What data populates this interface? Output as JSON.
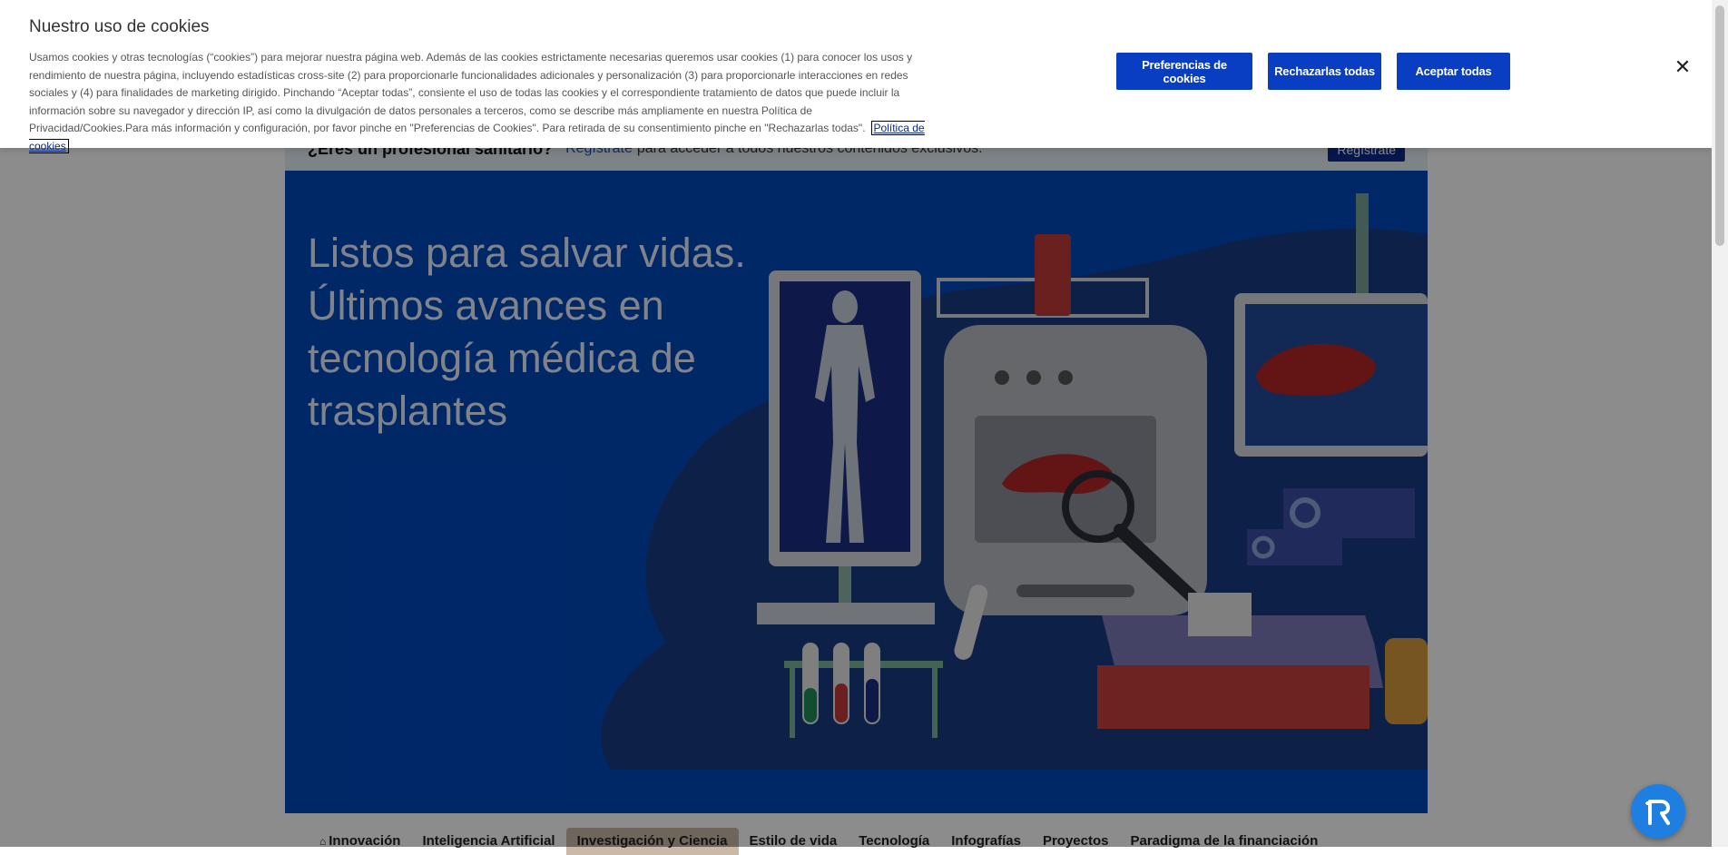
{
  "cookie_banner": {
    "title": "Nuestro uso de cookies",
    "description": "Usamos cookies y otras tecnologías (“cookies”) para mejorar nuestra página web. Además de las cookies estrictamente necesarias queremos usar cookies (1) para conocer los usos y rendimiento de nuestra página, incluyendo estadísticas cross-site (2) para proporcionarle funcionalidades adicionales y personalización (3) para proporcionarle interacciones en redes sociales y (4) para finalidades de marketing dirigido. Pinchando “Aceptar todas”, consiente el uso de todas las cookies y el correspondiente tratamiento de datos que puede incluir la información sobre su navegador y dirección IP, así como la divulgación de datos personales a terceros, como se describe más ampliamente en nuestra Política de Privacidad/Cookies.Para más información y configuración, por favor pinche en \"Preferencias de Cookies\". Para retirada de su consentimiento pinche en \"Rechazarlas todas\".",
    "policy_link": "Política de cookies",
    "buttons": {
      "preferences": "Preferencias de cookies",
      "reject_all": "Rechazarlas todas",
      "accept_all": "Aceptar todas"
    },
    "close_icon": "✕"
  },
  "promo_bar": {
    "question": "¿Eres un profesional sanitario?",
    "register_link": "Regístrate",
    "text": "para acceder a todos nuestros contenidos exclusivos.",
    "button": "Regístrate"
  },
  "hero": {
    "title": "Listos para salvar vidas. Últimos avances en tecnología médica de trasplantes"
  },
  "tabs": [
    {
      "label": "Innovación",
      "icon": "home-icon"
    },
    {
      "label": "Inteligencia Artificial"
    },
    {
      "label": "Investigación y Ciencia",
      "active": true
    },
    {
      "label": "Estilo de vida"
    },
    {
      "label": "Tecnología"
    },
    {
      "label": "Infografías"
    },
    {
      "label": "Proyectos"
    },
    {
      "label": "Paradigma de la financiación"
    }
  ],
  "assistant_button": {
    "icon": "assistant-icon"
  },
  "colors": {
    "primary_button": "#0a3ec2",
    "hero_bg": "#0047bb",
    "overlay": "rgba(0,0,0,0.45)"
  }
}
